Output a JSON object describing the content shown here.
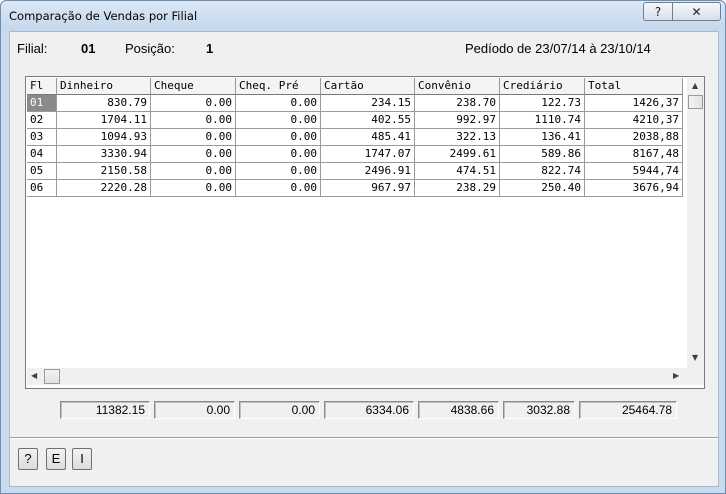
{
  "window": {
    "title": "Comparação de Vendas por Filial",
    "help_label": "?",
    "close_label": "✕"
  },
  "info": {
    "filial_label": "Filial:",
    "filial_value": "01",
    "posicao_label": "Posição:",
    "posicao_value": "1",
    "periodo": "Pedíodo de 23/07/14 à 23/10/14"
  },
  "grid": {
    "columns": [
      "Fl",
      "Dinheiro",
      "Cheque",
      "Cheq. Pré",
      "Cartão",
      "Convênio",
      "Crediário",
      "Total"
    ],
    "rows": [
      [
        "01",
        "830.79",
        "0.00",
        "0.00",
        "234.15",
        "238.70",
        "122.73",
        "1426,37"
      ],
      [
        "02",
        "1704.11",
        "0.00",
        "0.00",
        "402.55",
        "992.97",
        "1110.74",
        "4210,37"
      ],
      [
        "03",
        "1094.93",
        "0.00",
        "0.00",
        "485.41",
        "322.13",
        "136.41",
        "2038,88"
      ],
      [
        "04",
        "3330.94",
        "0.00",
        "0.00",
        "1747.07",
        "2499.61",
        "589.86",
        "8167,48"
      ],
      [
        "05",
        "2150.58",
        "0.00",
        "0.00",
        "2496.91",
        "474.51",
        "822.74",
        "5944,74"
      ],
      [
        "06",
        "2220.28",
        "0.00",
        "0.00",
        "967.97",
        "238.29",
        "250.40",
        "3676,94"
      ]
    ],
    "selected_row": 0
  },
  "totals": {
    "dinheiro": "11382.15",
    "cheque": "0.00",
    "cheq_pre": "0.00",
    "cartao": "6334.06",
    "convenio": "4838.66",
    "crediario": "3032.88",
    "total": "25464.78"
  },
  "buttons": {
    "help": "?",
    "e": "E",
    "i": "I"
  },
  "icons": {
    "scroll_up": "scroll-up-arrow-icon",
    "scroll_down": "scroll-down-arrow-icon",
    "scroll_left": "scroll-left-arrow-icon",
    "scroll_right": "scroll-right-arrow-icon"
  }
}
